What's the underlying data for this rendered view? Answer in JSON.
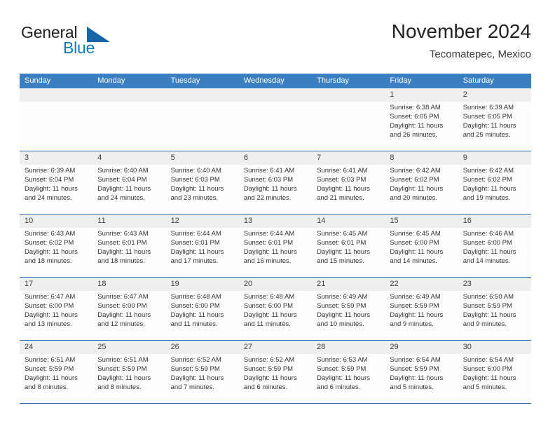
{
  "brand": {
    "name_part1": "General",
    "name_part2": "Blue",
    "logo_icon": "triangle-flag-icon",
    "accent_color": "#1278be",
    "triangle_color": "#1565a8"
  },
  "header": {
    "title": "November 2024",
    "subtitle": "Tecomatepec, Mexico"
  },
  "colors": {
    "header_row_bg": "#3c7fc1",
    "daynum_band_bg": "#efefef",
    "week_divider": "#2f6fb0",
    "cell_bg": "#fdfdfd",
    "text": "#333333"
  },
  "weekdays": [
    "Sunday",
    "Monday",
    "Tuesday",
    "Wednesday",
    "Thursday",
    "Friday",
    "Saturday"
  ],
  "weeks": [
    {
      "days": [
        {
          "num": "",
          "lines": []
        },
        {
          "num": "",
          "lines": []
        },
        {
          "num": "",
          "lines": []
        },
        {
          "num": "",
          "lines": []
        },
        {
          "num": "",
          "lines": []
        },
        {
          "num": "1",
          "lines": [
            "Sunrise: 6:38 AM",
            "Sunset: 6:05 PM",
            "Daylight: 11 hours",
            "and 26 minutes."
          ]
        },
        {
          "num": "2",
          "lines": [
            "Sunrise: 6:39 AM",
            "Sunset: 6:05 PM",
            "Daylight: 11 hours",
            "and 25 minutes."
          ]
        }
      ]
    },
    {
      "days": [
        {
          "num": "3",
          "lines": [
            "Sunrise: 6:39 AM",
            "Sunset: 6:04 PM",
            "Daylight: 11 hours",
            "and 24 minutes."
          ]
        },
        {
          "num": "4",
          "lines": [
            "Sunrise: 6:40 AM",
            "Sunset: 6:04 PM",
            "Daylight: 11 hours",
            "and 24 minutes."
          ]
        },
        {
          "num": "5",
          "lines": [
            "Sunrise: 6:40 AM",
            "Sunset: 6:03 PM",
            "Daylight: 11 hours",
            "and 23 minutes."
          ]
        },
        {
          "num": "6",
          "lines": [
            "Sunrise: 6:41 AM",
            "Sunset: 6:03 PM",
            "Daylight: 11 hours",
            "and 22 minutes."
          ]
        },
        {
          "num": "7",
          "lines": [
            "Sunrise: 6:41 AM",
            "Sunset: 6:03 PM",
            "Daylight: 11 hours",
            "and 21 minutes."
          ]
        },
        {
          "num": "8",
          "lines": [
            "Sunrise: 6:42 AM",
            "Sunset: 6:02 PM",
            "Daylight: 11 hours",
            "and 20 minutes."
          ]
        },
        {
          "num": "9",
          "lines": [
            "Sunrise: 6:42 AM",
            "Sunset: 6:02 PM",
            "Daylight: 11 hours",
            "and 19 minutes."
          ]
        }
      ]
    },
    {
      "days": [
        {
          "num": "10",
          "lines": [
            "Sunrise: 6:43 AM",
            "Sunset: 6:02 PM",
            "Daylight: 11 hours",
            "and 18 minutes."
          ]
        },
        {
          "num": "11",
          "lines": [
            "Sunrise: 6:43 AM",
            "Sunset: 6:01 PM",
            "Daylight: 11 hours",
            "and 18 minutes."
          ]
        },
        {
          "num": "12",
          "lines": [
            "Sunrise: 6:44 AM",
            "Sunset: 6:01 PM",
            "Daylight: 11 hours",
            "and 17 minutes."
          ]
        },
        {
          "num": "13",
          "lines": [
            "Sunrise: 6:44 AM",
            "Sunset: 6:01 PM",
            "Daylight: 11 hours",
            "and 16 minutes."
          ]
        },
        {
          "num": "14",
          "lines": [
            "Sunrise: 6:45 AM",
            "Sunset: 6:01 PM",
            "Daylight: 11 hours",
            "and 15 minutes."
          ]
        },
        {
          "num": "15",
          "lines": [
            "Sunrise: 6:45 AM",
            "Sunset: 6:00 PM",
            "Daylight: 11 hours",
            "and 14 minutes."
          ]
        },
        {
          "num": "16",
          "lines": [
            "Sunrise: 6:46 AM",
            "Sunset: 6:00 PM",
            "Daylight: 11 hours",
            "and 14 minutes."
          ]
        }
      ]
    },
    {
      "days": [
        {
          "num": "17",
          "lines": [
            "Sunrise: 6:47 AM",
            "Sunset: 6:00 PM",
            "Daylight: 11 hours",
            "and 13 minutes."
          ]
        },
        {
          "num": "18",
          "lines": [
            "Sunrise: 6:47 AM",
            "Sunset: 6:00 PM",
            "Daylight: 11 hours",
            "and 12 minutes."
          ]
        },
        {
          "num": "19",
          "lines": [
            "Sunrise: 6:48 AM",
            "Sunset: 6:00 PM",
            "Daylight: 11 hours",
            "and 11 minutes."
          ]
        },
        {
          "num": "20",
          "lines": [
            "Sunrise: 6:48 AM",
            "Sunset: 6:00 PM",
            "Daylight: 11 hours",
            "and 11 minutes."
          ]
        },
        {
          "num": "21",
          "lines": [
            "Sunrise: 6:49 AM",
            "Sunset: 5:59 PM",
            "Daylight: 11 hours",
            "and 10 minutes."
          ]
        },
        {
          "num": "22",
          "lines": [
            "Sunrise: 6:49 AM",
            "Sunset: 5:59 PM",
            "Daylight: 11 hours",
            "and 9 minutes."
          ]
        },
        {
          "num": "23",
          "lines": [
            "Sunrise: 6:50 AM",
            "Sunset: 5:59 PM",
            "Daylight: 11 hours",
            "and 9 minutes."
          ]
        }
      ]
    },
    {
      "days": [
        {
          "num": "24",
          "lines": [
            "Sunrise: 6:51 AM",
            "Sunset: 5:59 PM",
            "Daylight: 11 hours",
            "and 8 minutes."
          ]
        },
        {
          "num": "25",
          "lines": [
            "Sunrise: 6:51 AM",
            "Sunset: 5:59 PM",
            "Daylight: 11 hours",
            "and 8 minutes."
          ]
        },
        {
          "num": "26",
          "lines": [
            "Sunrise: 6:52 AM",
            "Sunset: 5:59 PM",
            "Daylight: 11 hours",
            "and 7 minutes."
          ]
        },
        {
          "num": "27",
          "lines": [
            "Sunrise: 6:52 AM",
            "Sunset: 5:59 PM",
            "Daylight: 11 hours",
            "and 6 minutes."
          ]
        },
        {
          "num": "28",
          "lines": [
            "Sunrise: 6:53 AM",
            "Sunset: 5:59 PM",
            "Daylight: 11 hours",
            "and 6 minutes."
          ]
        },
        {
          "num": "29",
          "lines": [
            "Sunrise: 6:54 AM",
            "Sunset: 5:59 PM",
            "Daylight: 11 hours",
            "and 5 minutes."
          ]
        },
        {
          "num": "30",
          "lines": [
            "Sunrise: 6:54 AM",
            "Sunset: 6:00 PM",
            "Daylight: 11 hours",
            "and 5 minutes."
          ]
        }
      ]
    }
  ]
}
